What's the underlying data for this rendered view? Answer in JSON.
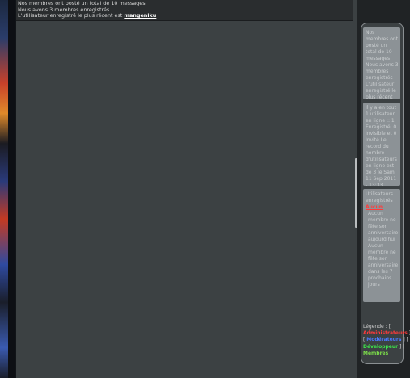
{
  "stats": {
    "line1": "Nos membres ont posté un total de 10 messages",
    "line2": "Nous avons 3 membres enregistrés",
    "line3_prefix": "L'utilisateur enregistré le plus récent est ",
    "latest_user": "mangeniku"
  },
  "sidebar": {
    "panel1": {
      "text": "Nos membres ont posté un total de 10 messages Nous avons 3 membres enregistrés L'utilisateur enregistré le plus récent est",
      "latest_user": "mangeniku"
    },
    "panel2": {
      "text": "Il y a en tout 1 utilisateur en ligne :: 1 Enregistré, 0 Invisible et 0 Invité Le record du nombre d'utilisateurs en ligne est de 3 le Sam 11 Sep 2011 - 13:33"
    },
    "panel3": {
      "intro": "Utilisateurs enregistrés :",
      "none_label": "Aucun",
      "text": "Aucun membre ne fête son anniversaire aujourd'hui Aucun membre ne fête son anniversaire dans les 7 prochains jours"
    },
    "legend": {
      "label": "Légende : [",
      "admin": "Administrateurs",
      "moderator": "Modérateurs",
      "developer": "Développeur",
      "member": "Membres",
      "colors": {
        "admin": "#ff3b3b",
        "moderator": "#4a78ff",
        "developer": "#3ce44a",
        "member": "#7de04a"
      }
    }
  }
}
